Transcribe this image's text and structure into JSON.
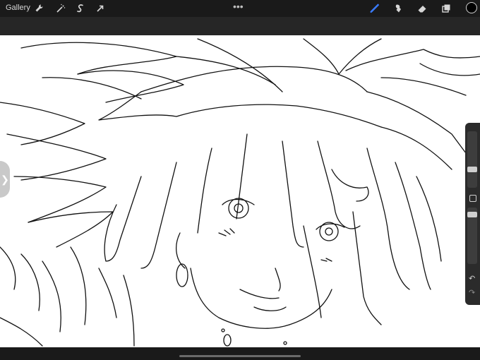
{
  "toolbar": {
    "gallery_label": "Gallery",
    "actions_icon": "wrench-icon",
    "adjustments_icon": "magic-wand-icon",
    "selection_icon": "selection-s-icon",
    "transform_icon": "arrow-cursor-icon",
    "more_label": "•••",
    "brush_icon": "brush-icon",
    "smudge_icon": "smudge-icon",
    "eraser_icon": "eraser-icon",
    "layers_icon": "layers-icon",
    "current_color": "#000000",
    "accent_color": "#3a7bff"
  },
  "sidebar": {
    "brush_size_level": 0.55,
    "opacity_level": 0.0,
    "undo_label": "↶",
    "redo_label": "↷"
  },
  "canvas": {
    "background": "#ffffff",
    "content": "line-art-illustration"
  }
}
